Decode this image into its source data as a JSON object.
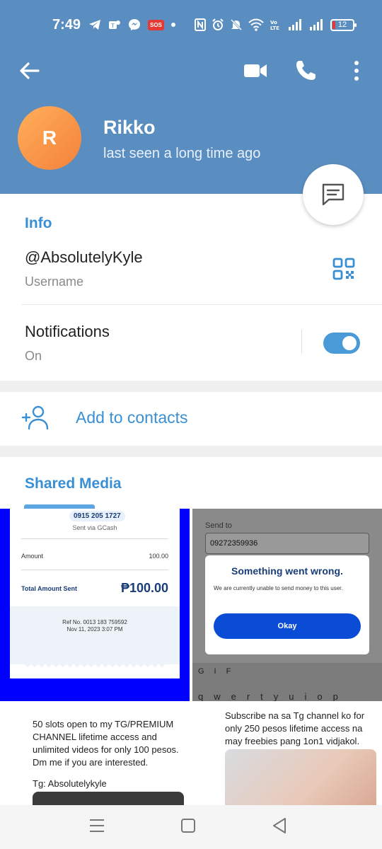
{
  "status_bar": {
    "time": "7:49",
    "sos": "SOS",
    "battery": "12"
  },
  "header": {
    "avatar_initial": "R",
    "name": "Rikko",
    "status": "last seen a long time ago",
    "bg_color": "#5b8ec0"
  },
  "info": {
    "title": "Info",
    "username": "@AbsolutelyKyle",
    "username_label": "Username",
    "notifications_label": "Notifications",
    "notifications_value": "On",
    "notifications_enabled": true
  },
  "add_contact": {
    "label": "Add to contacts"
  },
  "shared_media": {
    "title": "Shared Media",
    "items": [
      {
        "phone": "0915 205 1727",
        "via": "Sent via GCash",
        "amount_label": "Amount",
        "amount_value": "100.00",
        "total_label": "Total Amount Sent",
        "total_value": "₱100.00",
        "ref": "Ref No. 0013 183 759592",
        "date": "Nov 11, 2023 3:07 PM"
      },
      {
        "send_to_label": "Send to",
        "number": "09272359936",
        "dialog_title": "Something went wrong.",
        "dialog_body": "We are currently unable to send money to this user.",
        "button": "Okay",
        "keyboard_toolbar": "GIF",
        "keyboard_row": "qwertyuiop"
      },
      {
        "text": "50 slots open to my TG/PREMIUM CHANNEL lifetime access and unlimited videos for only 100 pesos. Dm me if you are interested.",
        "tg": "Tg: Absolutelykyle"
      },
      {
        "text": "Subscribe na sa Tg channel ko for only 250 pesos lifetime access na may freebies pang 1on1 vidjakol."
      }
    ]
  },
  "colors": {
    "accent": "#3a8fd3",
    "toggle": "#4b9ad8",
    "avatar_gradient": "#f4813a"
  }
}
